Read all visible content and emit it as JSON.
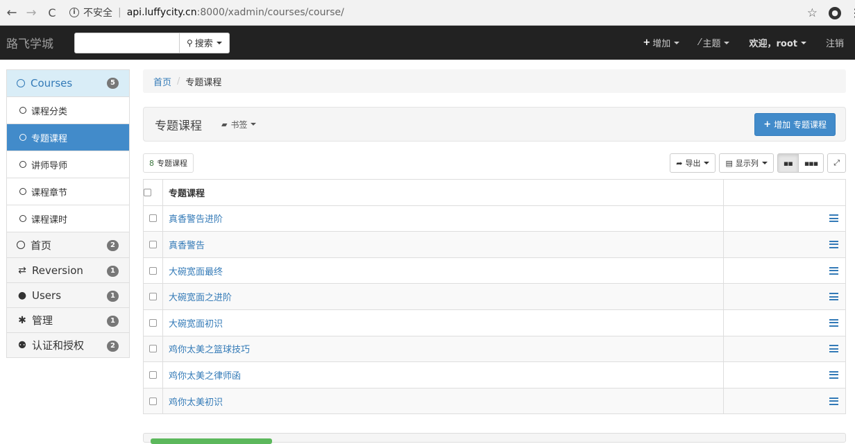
{
  "browser": {
    "security_label": "不安全",
    "url_host": "api.luffycity.cn",
    "url_rest": ":8000/xadmin/courses/course/"
  },
  "navbar": {
    "brand": "路飞学城",
    "search_button": "搜索",
    "add_label": "增加",
    "theme_label": "主题",
    "welcome_label": "欢迎，root",
    "logout_label": "注销"
  },
  "sidebar": {
    "groups": [
      {
        "label": "Courses",
        "badge": "5",
        "icon": "circle-icon"
      },
      {
        "label": "首页",
        "badge": "2",
        "icon": "circle-icon"
      },
      {
        "label": "Reversion",
        "badge": "1",
        "icon": "exchange-icon"
      },
      {
        "label": "Users",
        "badge": "1",
        "icon": "user-icon"
      },
      {
        "label": "管理",
        "badge": "1",
        "icon": "gear-icon"
      },
      {
        "label": "认证和授权",
        "badge": "2",
        "icon": "group-icon"
      }
    ],
    "sub_items": [
      "课程分类",
      "专题课程",
      "讲师导师",
      "课程章节",
      "课程课时"
    ],
    "active_sub": "专题课程"
  },
  "breadcrumb": {
    "home": "首页",
    "current": "专题课程"
  },
  "page": {
    "title": "专题课程",
    "bookmark_label": "书签",
    "add_button": "增加 专题课程"
  },
  "toolbar": {
    "count_num": "8",
    "count_label": "专题课程",
    "export_label": "导出",
    "columns_label": "显示列"
  },
  "table": {
    "header": "专题课程",
    "rows": [
      "真香警告进阶",
      "真香警告",
      "大碗宽面最终",
      "大碗宽面之进阶",
      "大碗宽面初识",
      "鸡你太美之篮球技巧",
      "鸡你太美之律师函",
      "鸡你太美初识"
    ]
  },
  "colors": {
    "navbar_bg": "#222222",
    "primary": "#428bca",
    "link": "#337ab7",
    "active_group_bg": "#d9edf7"
  }
}
